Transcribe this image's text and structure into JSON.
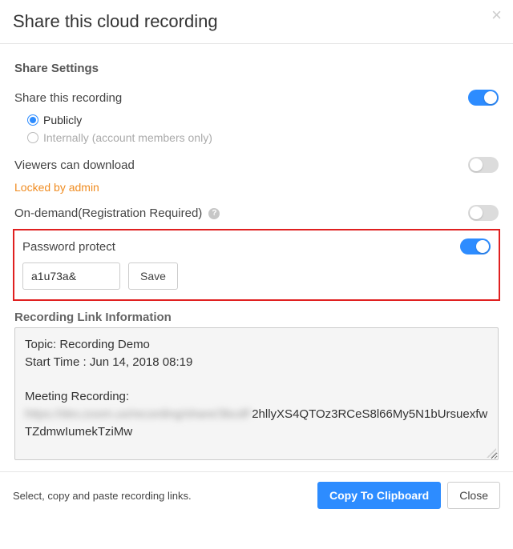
{
  "modal": {
    "title": "Share this cloud recording",
    "close_glyph": "×"
  },
  "settings": {
    "heading": "Share Settings",
    "share_this_recording": {
      "label": "Share this recording",
      "enabled": true,
      "options": {
        "public": {
          "label": "Publicly",
          "selected": true
        },
        "internal": {
          "label": "Internally (account members only)",
          "selected": false
        }
      }
    },
    "viewers_download": {
      "label": "Viewers can download",
      "enabled": false,
      "locked_note": "Locked by admin"
    },
    "on_demand": {
      "label": "On-demand(Registration Required)",
      "enabled": false,
      "help_glyph": "?"
    },
    "password_protect": {
      "label": "Password protect",
      "enabled": true,
      "password_value": "a1u73a&",
      "save_label": "Save"
    }
  },
  "link_info": {
    "heading": "Recording Link Information",
    "topic_line": "Topic: Recording Demo",
    "start_time_line": "Start Time : Jun 14, 2018 08:19",
    "meeting_recording_label": "Meeting Recording:",
    "url_blurred_prefix": "https://dev.zoom.us/recording/share/3bcdF",
    "url_visible_suffix": "2hllyXS4QTOz3RCeS8l66My5N1bUrsuexfwTZdmwIumekTziMw"
  },
  "footer": {
    "instruction": "Select, copy and paste recording links.",
    "copy_label": "Copy To Clipboard",
    "close_label": "Close"
  }
}
